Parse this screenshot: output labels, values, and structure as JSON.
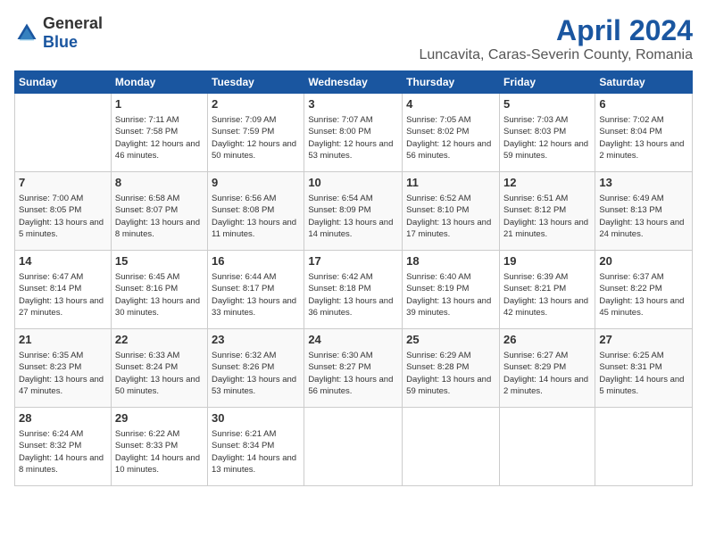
{
  "header": {
    "logo_general": "General",
    "logo_blue": "Blue",
    "month": "April 2024",
    "location": "Luncavita, Caras-Severin County, Romania"
  },
  "days_of_week": [
    "Sunday",
    "Monday",
    "Tuesday",
    "Wednesday",
    "Thursday",
    "Friday",
    "Saturday"
  ],
  "weeks": [
    [
      {
        "day": "",
        "sunrise": "",
        "sunset": "",
        "daylight": ""
      },
      {
        "day": "1",
        "sunrise": "Sunrise: 7:11 AM",
        "sunset": "Sunset: 7:58 PM",
        "daylight": "Daylight: 12 hours and 46 minutes."
      },
      {
        "day": "2",
        "sunrise": "Sunrise: 7:09 AM",
        "sunset": "Sunset: 7:59 PM",
        "daylight": "Daylight: 12 hours and 50 minutes."
      },
      {
        "day": "3",
        "sunrise": "Sunrise: 7:07 AM",
        "sunset": "Sunset: 8:00 PM",
        "daylight": "Daylight: 12 hours and 53 minutes."
      },
      {
        "day": "4",
        "sunrise": "Sunrise: 7:05 AM",
        "sunset": "Sunset: 8:02 PM",
        "daylight": "Daylight: 12 hours and 56 minutes."
      },
      {
        "day": "5",
        "sunrise": "Sunrise: 7:03 AM",
        "sunset": "Sunset: 8:03 PM",
        "daylight": "Daylight: 12 hours and 59 minutes."
      },
      {
        "day": "6",
        "sunrise": "Sunrise: 7:02 AM",
        "sunset": "Sunset: 8:04 PM",
        "daylight": "Daylight: 13 hours and 2 minutes."
      }
    ],
    [
      {
        "day": "7",
        "sunrise": "Sunrise: 7:00 AM",
        "sunset": "Sunset: 8:05 PM",
        "daylight": "Daylight: 13 hours and 5 minutes."
      },
      {
        "day": "8",
        "sunrise": "Sunrise: 6:58 AM",
        "sunset": "Sunset: 8:07 PM",
        "daylight": "Daylight: 13 hours and 8 minutes."
      },
      {
        "day": "9",
        "sunrise": "Sunrise: 6:56 AM",
        "sunset": "Sunset: 8:08 PM",
        "daylight": "Daylight: 13 hours and 11 minutes."
      },
      {
        "day": "10",
        "sunrise": "Sunrise: 6:54 AM",
        "sunset": "Sunset: 8:09 PM",
        "daylight": "Daylight: 13 hours and 14 minutes."
      },
      {
        "day": "11",
        "sunrise": "Sunrise: 6:52 AM",
        "sunset": "Sunset: 8:10 PM",
        "daylight": "Daylight: 13 hours and 17 minutes."
      },
      {
        "day": "12",
        "sunrise": "Sunrise: 6:51 AM",
        "sunset": "Sunset: 8:12 PM",
        "daylight": "Daylight: 13 hours and 21 minutes."
      },
      {
        "day": "13",
        "sunrise": "Sunrise: 6:49 AM",
        "sunset": "Sunset: 8:13 PM",
        "daylight": "Daylight: 13 hours and 24 minutes."
      }
    ],
    [
      {
        "day": "14",
        "sunrise": "Sunrise: 6:47 AM",
        "sunset": "Sunset: 8:14 PM",
        "daylight": "Daylight: 13 hours and 27 minutes."
      },
      {
        "day": "15",
        "sunrise": "Sunrise: 6:45 AM",
        "sunset": "Sunset: 8:16 PM",
        "daylight": "Daylight: 13 hours and 30 minutes."
      },
      {
        "day": "16",
        "sunrise": "Sunrise: 6:44 AM",
        "sunset": "Sunset: 8:17 PM",
        "daylight": "Daylight: 13 hours and 33 minutes."
      },
      {
        "day": "17",
        "sunrise": "Sunrise: 6:42 AM",
        "sunset": "Sunset: 8:18 PM",
        "daylight": "Daylight: 13 hours and 36 minutes."
      },
      {
        "day": "18",
        "sunrise": "Sunrise: 6:40 AM",
        "sunset": "Sunset: 8:19 PM",
        "daylight": "Daylight: 13 hours and 39 minutes."
      },
      {
        "day": "19",
        "sunrise": "Sunrise: 6:39 AM",
        "sunset": "Sunset: 8:21 PM",
        "daylight": "Daylight: 13 hours and 42 minutes."
      },
      {
        "day": "20",
        "sunrise": "Sunrise: 6:37 AM",
        "sunset": "Sunset: 8:22 PM",
        "daylight": "Daylight: 13 hours and 45 minutes."
      }
    ],
    [
      {
        "day": "21",
        "sunrise": "Sunrise: 6:35 AM",
        "sunset": "Sunset: 8:23 PM",
        "daylight": "Daylight: 13 hours and 47 minutes."
      },
      {
        "day": "22",
        "sunrise": "Sunrise: 6:33 AM",
        "sunset": "Sunset: 8:24 PM",
        "daylight": "Daylight: 13 hours and 50 minutes."
      },
      {
        "day": "23",
        "sunrise": "Sunrise: 6:32 AM",
        "sunset": "Sunset: 8:26 PM",
        "daylight": "Daylight: 13 hours and 53 minutes."
      },
      {
        "day": "24",
        "sunrise": "Sunrise: 6:30 AM",
        "sunset": "Sunset: 8:27 PM",
        "daylight": "Daylight: 13 hours and 56 minutes."
      },
      {
        "day": "25",
        "sunrise": "Sunrise: 6:29 AM",
        "sunset": "Sunset: 8:28 PM",
        "daylight": "Daylight: 13 hours and 59 minutes."
      },
      {
        "day": "26",
        "sunrise": "Sunrise: 6:27 AM",
        "sunset": "Sunset: 8:29 PM",
        "daylight": "Daylight: 14 hours and 2 minutes."
      },
      {
        "day": "27",
        "sunrise": "Sunrise: 6:25 AM",
        "sunset": "Sunset: 8:31 PM",
        "daylight": "Daylight: 14 hours and 5 minutes."
      }
    ],
    [
      {
        "day": "28",
        "sunrise": "Sunrise: 6:24 AM",
        "sunset": "Sunset: 8:32 PM",
        "daylight": "Daylight: 14 hours and 8 minutes."
      },
      {
        "day": "29",
        "sunrise": "Sunrise: 6:22 AM",
        "sunset": "Sunset: 8:33 PM",
        "daylight": "Daylight: 14 hours and 10 minutes."
      },
      {
        "day": "30",
        "sunrise": "Sunrise: 6:21 AM",
        "sunset": "Sunset: 8:34 PM",
        "daylight": "Daylight: 14 hours and 13 minutes."
      },
      {
        "day": "",
        "sunrise": "",
        "sunset": "",
        "daylight": ""
      },
      {
        "day": "",
        "sunrise": "",
        "sunset": "",
        "daylight": ""
      },
      {
        "day": "",
        "sunrise": "",
        "sunset": "",
        "daylight": ""
      },
      {
        "day": "",
        "sunrise": "",
        "sunset": "",
        "daylight": ""
      }
    ]
  ]
}
